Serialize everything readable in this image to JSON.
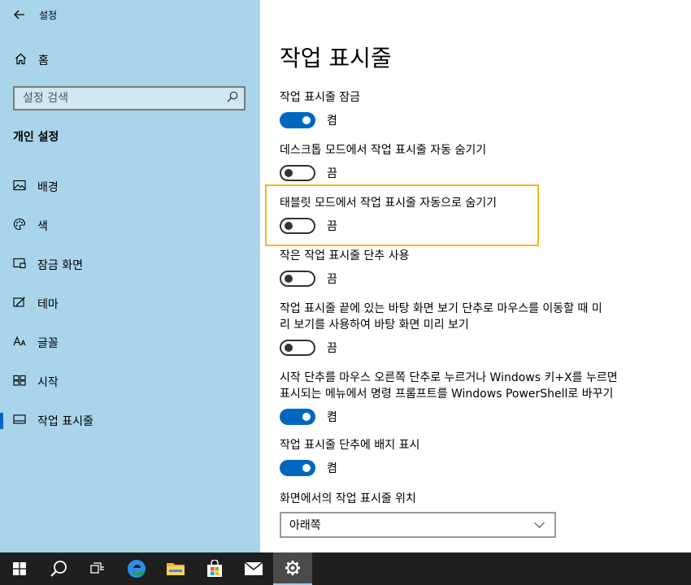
{
  "app": {
    "title": "설정"
  },
  "sidebar": {
    "home_label": "홈",
    "search_placeholder": "설정 검색",
    "section_title": "개인 설정",
    "items": [
      {
        "label": "배경",
        "icon": "picture-icon"
      },
      {
        "label": "색",
        "icon": "palette-icon"
      },
      {
        "label": "잠금 화면",
        "icon": "lock-screen-icon"
      },
      {
        "label": "테마",
        "icon": "theme-icon"
      },
      {
        "label": "글꼴",
        "icon": "font-icon"
      },
      {
        "label": "시작",
        "icon": "start-icon"
      },
      {
        "label": "작업 표시줄",
        "icon": "taskbar-icon",
        "active": true
      }
    ]
  },
  "main": {
    "title": "작업 표시줄",
    "settings": [
      {
        "label": "작업 표시줄 잠금",
        "state": "켬",
        "on": true
      },
      {
        "label": "데스크톱 모드에서 작업 표시줄 자동 숨기기",
        "state": "끔",
        "on": false
      },
      {
        "label": "태블릿 모드에서 작업 표시줄 자동으로 숨기기",
        "state": "끔",
        "on": false,
        "highlighted": true
      },
      {
        "label": "작은 작업 표시줄 단추 사용",
        "state": "끔",
        "on": false
      },
      {
        "label_line1": "작업 표시줄 끝에 있는 바탕 화면 보기 단추로 마우스를 이동할 때 미",
        "label_line2": "리 보기를 사용하여 바탕 화면 미리 보기",
        "state": "끔",
        "on": false
      },
      {
        "label_line1": "시작 단추를 마우스 오른쪽 단추로 누르거나 Windows 키+X를 누르면",
        "label_line2": "표시되는 메뉴에서 명령 프롬프트를 Windows PowerShell로 바꾸기",
        "state": "켬",
        "on": true
      },
      {
        "label": "작업 표시줄 단추에 배지 표시",
        "state": "켬",
        "on": true
      }
    ],
    "position_label": "화면에서의 작업 표시줄 위치",
    "position_value": "아래쪽"
  },
  "taskbar": {
    "items": [
      "windows-start-icon",
      "search-icon",
      "task-view-icon",
      "edge-icon",
      "file-explorer-icon",
      "store-icon",
      "mail-icon",
      "settings-gear-icon"
    ],
    "highlight_color": "#f7b51b",
    "accent_color": "#0067c0"
  }
}
